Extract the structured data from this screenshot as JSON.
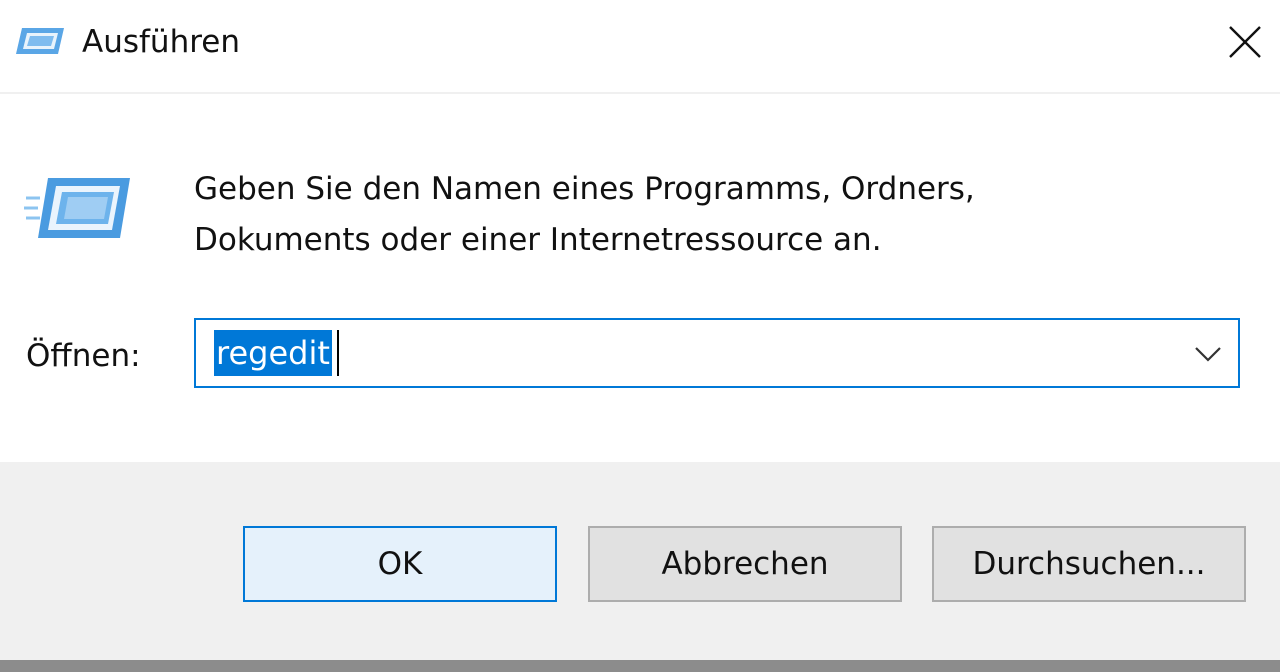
{
  "window": {
    "title": "Ausführen",
    "title_icon": "run-dialog-icon",
    "close_icon": "close-icon"
  },
  "content": {
    "icon": "run-dialog-icon",
    "description_line1": "Geben Sie den Namen eines Programms, Ordners,",
    "description_line2": "Dokuments oder einer Internetressource an.",
    "open_label": "Öffnen:",
    "open_value": "regedit",
    "dropdown_icon": "chevron-down-icon"
  },
  "buttons": {
    "ok": "OK",
    "cancel": "Abbrechen",
    "browse": "Durchsuchen..."
  },
  "colors": {
    "accent": "#0078d7",
    "footer_bg": "#f0f0f0",
    "button_bg": "#e1e1e1",
    "button_border": "#adadad",
    "ok_button_bg": "#e5f1fb"
  }
}
